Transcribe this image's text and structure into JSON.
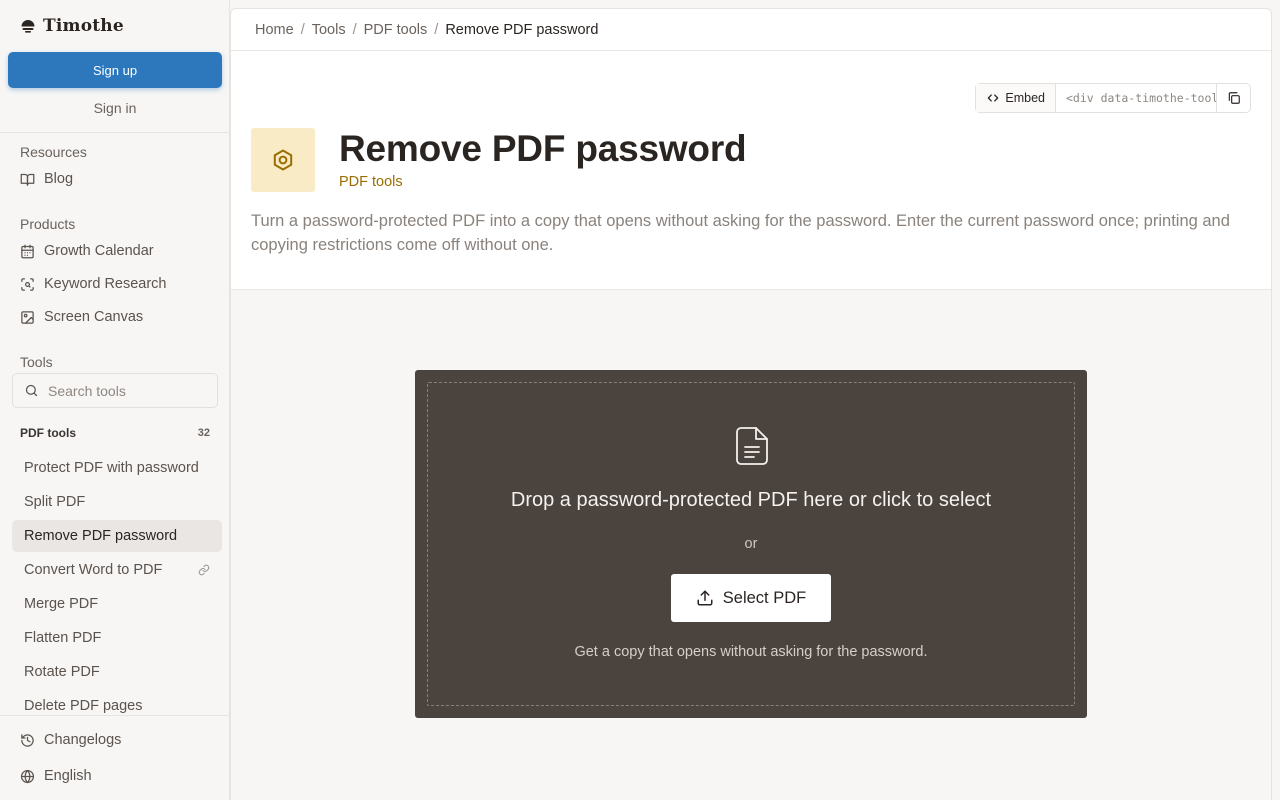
{
  "app": {
    "logo_text": "Timothe",
    "signup_label": "Sign up",
    "signin_label": "Sign in"
  },
  "sidebar": {
    "resources_heading": "Resources",
    "resources": [
      {
        "label": "Blog",
        "icon": "book-icon"
      }
    ],
    "products_heading": "Products",
    "products": [
      {
        "label": "Growth Calendar",
        "icon": "calendar-icon"
      },
      {
        "label": "Keyword Research",
        "icon": "scan-search-icon"
      },
      {
        "label": "Screen Canvas",
        "icon": "image-icon"
      }
    ],
    "tools_heading": "Tools",
    "search_placeholder": "Search tools",
    "pdf_group_label": "PDF tools",
    "pdf_group_count": "32",
    "pdf_tools": [
      {
        "label": "Protect PDF with password",
        "active": false
      },
      {
        "label": "Split PDF",
        "active": false
      },
      {
        "label": "Remove PDF password",
        "active": true
      },
      {
        "label": "Convert Word to PDF",
        "active": false,
        "icon": "link-icon"
      },
      {
        "label": "Merge PDF",
        "active": false
      },
      {
        "label": "Flatten PDF",
        "active": false
      },
      {
        "label": "Rotate PDF",
        "active": false
      },
      {
        "label": "Delete PDF pages",
        "active": false
      }
    ],
    "footer": [
      {
        "label": "Changelogs",
        "icon": "history-icon"
      },
      {
        "label": "English",
        "icon": "globe-icon"
      }
    ]
  },
  "breadcrumb": [
    "Home",
    "Tools",
    "PDF tools",
    "Remove PDF password"
  ],
  "embed": {
    "button_label": "Embed",
    "code_value": "<div data-timothe-tool=\"remove-pdf-password\"></div>"
  },
  "page": {
    "title": "Remove PDF password",
    "category": "PDF tools",
    "description": "Turn a password-protected PDF into a copy that opens without asking for the password. Enter the current password once; printing and copying restrictions come off without one.",
    "icon": "hexagon-nut-icon"
  },
  "dropzone": {
    "title": "Drop a password-protected PDF here or click to select",
    "or_label": "or",
    "button_label": "Select PDF",
    "hint": "Get a copy that opens without asking for the password."
  },
  "colors": {
    "accent": "#2d78bd",
    "category": "#9a6d00",
    "tool_icon_bg": "#f9ebc6",
    "dropzone_bg": "#4a433e"
  }
}
